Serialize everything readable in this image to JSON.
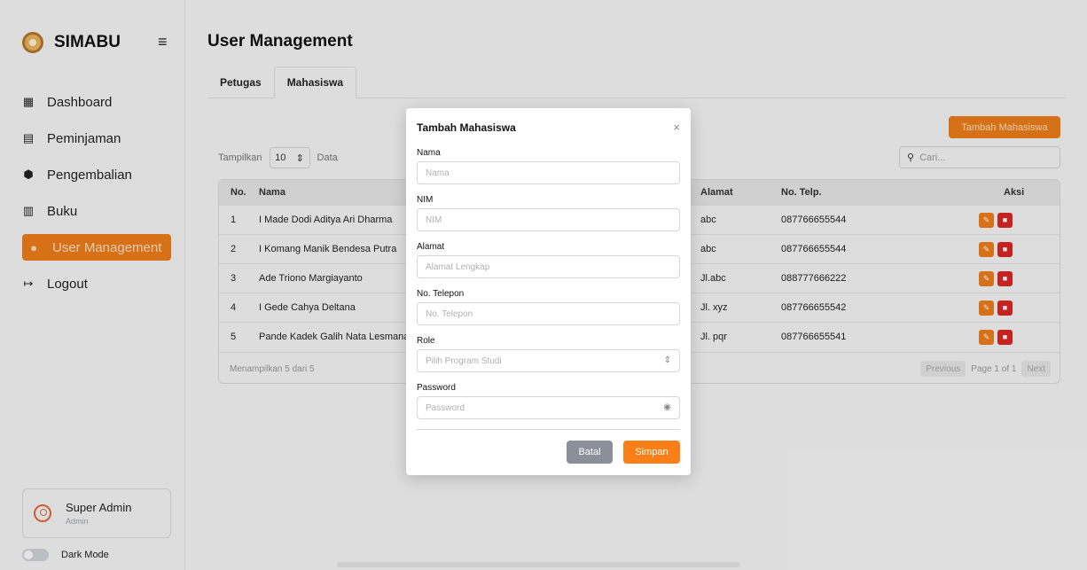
{
  "brand": {
    "name": "SIMABU",
    "logo_icon": "library-logo-icon",
    "menu_icon": "hamburger-icon"
  },
  "sidebar": {
    "items": [
      {
        "label": "Dashboard",
        "icon": "dashboard-icon"
      },
      {
        "label": "Peminjaman",
        "icon": "borrow-icon"
      },
      {
        "label": "Pengembalian",
        "icon": "return-icon"
      },
      {
        "label": "Buku",
        "icon": "books-icon"
      },
      {
        "label": "User Management",
        "icon": "users-icon",
        "active": true
      },
      {
        "label": "Logout",
        "icon": "logout-icon"
      }
    ],
    "user": {
      "name": "Super Admin",
      "role": "Admin"
    },
    "dark_mode_label": "Dark Mode"
  },
  "page": {
    "title": "User Management",
    "tabs": [
      {
        "label": "Petugas"
      },
      {
        "label": "Mahasiswa",
        "active": true
      }
    ],
    "add_button": "Tambah Mahasiswa",
    "show_prefix": "Tampilkan",
    "show_value": "10",
    "show_suffix": "Data",
    "search_placeholder": "Cari..."
  },
  "table": {
    "headers": {
      "no": "No.",
      "nama": "Nama",
      "alamat": "Alamat",
      "telp": "No. Telp.",
      "aksi": "Aksi"
    },
    "rows": [
      {
        "no": "1",
        "nama": "I Made Dodi Aditya Ari Dharma",
        "alamat": "abc",
        "telp": "087766655544"
      },
      {
        "no": "2",
        "nama": "I Komang Manik Bendesa Putra",
        "alamat": "abc",
        "telp": "087766655544"
      },
      {
        "no": "3",
        "nama": "Ade Triono Margiayanto",
        "alamat": "Jl.abc",
        "telp": "088777666222"
      },
      {
        "no": "4",
        "nama": "I Gede Cahya Deltana",
        "alamat": "Jl. xyz",
        "telp": "087766655542"
      },
      {
        "no": "5",
        "nama": "Pande Kadek Galih Nata Lesmana",
        "alamat": "Jl. pqr",
        "telp": "087766655541"
      }
    ],
    "footer_info": "Menampilkan 5 dari 5",
    "pager": {
      "previous": "Previous",
      "page_text": "Page 1 of 1",
      "next": "Next"
    }
  },
  "modal": {
    "title": "Tambah Mahasiswa",
    "fields": {
      "nama": {
        "label": "Nama",
        "placeholder": "Nama"
      },
      "nim": {
        "label": "NIM",
        "placeholder": "NIM"
      },
      "alamat": {
        "label": "Alamat",
        "placeholder": "Alamat Lengkap"
      },
      "telepon": {
        "label": "No. Telepon",
        "placeholder": "No. Telepon"
      },
      "role": {
        "label": "Role",
        "placeholder": "Pilih Program Studi"
      },
      "password": {
        "label": "Password",
        "placeholder": "Password"
      }
    },
    "cancel_label": "Batal",
    "save_label": "Simpan"
  },
  "colors": {
    "accent": "#ef7e1a",
    "danger": "#dc2626",
    "cancel": "#8a8f99"
  }
}
